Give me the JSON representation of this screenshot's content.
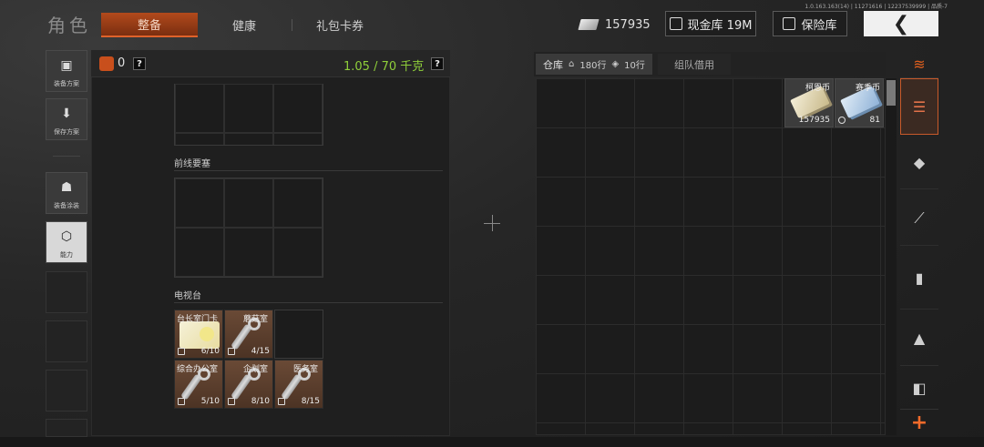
{
  "header": {
    "title": "角色",
    "tabs": [
      {
        "label": "整备",
        "active": true
      },
      {
        "label": "健康",
        "active": false
      },
      {
        "label": "礼包卡券",
        "active": false
      }
    ],
    "build_info": "1.0.163.163(14) | 11271616 | 12237539999 | 品质-7",
    "currency_amount": "157935",
    "cash_vault_label": "现金库 19M",
    "safe_label": "保险库",
    "back_icon": "chevron-left-icon"
  },
  "left_sidebar": {
    "buttons": [
      {
        "label": "装备方案",
        "icon": "vest-icon"
      },
      {
        "label": "保存方案",
        "icon": "download-icon"
      },
      {
        "label": "装备涂装",
        "icon": "helmet-icon"
      },
      {
        "label": "能力",
        "icon": "ability-icon"
      }
    ]
  },
  "loadout": {
    "bag_count": "0",
    "help": "?",
    "weight": "1.05 / 70 千克",
    "sections": [
      {
        "title": "前线要塞"
      },
      {
        "title": "电视台"
      }
    ],
    "tv_items": [
      {
        "name": "台长室门卡",
        "count": "6/10",
        "type": "card"
      },
      {
        "name": "蘑菇室",
        "count": "4/15",
        "type": "key"
      },
      {
        "name": "综合办公室",
        "count": "5/10",
        "type": "key"
      },
      {
        "name": "企划室",
        "count": "8/10",
        "type": "key"
      },
      {
        "name": "医务室",
        "count": "8/15",
        "type": "key"
      }
    ]
  },
  "warehouse": {
    "tab_label": "仓库",
    "rows_label": "180行",
    "extra_rows_label": "10行",
    "team_tab": "组队借用",
    "items": [
      {
        "name": "柯恩币",
        "count": "157935"
      },
      {
        "name": "赛季币",
        "count": "81"
      }
    ]
  },
  "right_sidebar": {
    "icons": [
      "layers-icon",
      "stack-icon",
      "vest-icon",
      "rifle-icon",
      "magazine-icon",
      "ammo-icon",
      "backpack-icon"
    ],
    "add": "+"
  },
  "colors": {
    "accent": "#c84f1c",
    "weight": "#8fcf3a"
  }
}
